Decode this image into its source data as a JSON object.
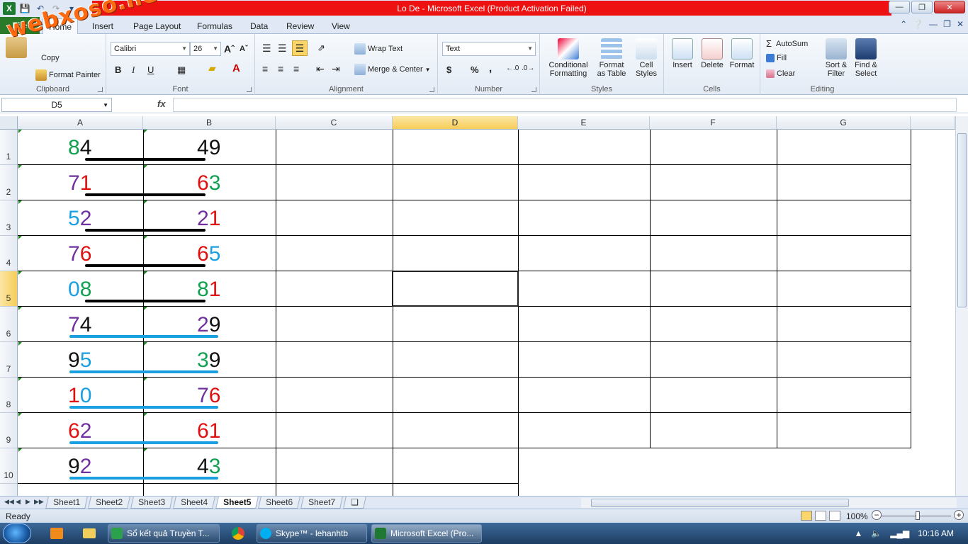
{
  "window": {
    "title": "Lo De  -  Microsoft Excel (Product Activation Failed)"
  },
  "logo": {
    "text": "webxoso.net"
  },
  "tabs": {
    "file": "File",
    "items": [
      "Home",
      "Insert",
      "Page Layout",
      "Formulas",
      "Data",
      "Review",
      "View"
    ],
    "active": "Home"
  },
  "clipboard": {
    "copy": "Copy",
    "format_painter": "Format Painter",
    "label": "Clipboard"
  },
  "font": {
    "name": "Calibri",
    "size": "26",
    "bold": "B",
    "italic": "I",
    "underline": "U",
    "label": "Font"
  },
  "alignment": {
    "wrap": "Wrap Text",
    "merge": "Merge & Center",
    "label": "Alignment"
  },
  "number": {
    "format": "Text",
    "currency": "$",
    "percent": "%",
    "comma": ",",
    "label": "Number"
  },
  "styles": {
    "conditional": [
      "Conditional",
      "Formatting"
    ],
    "table": [
      "Format",
      "as Table"
    ],
    "cell": [
      "Cell",
      "Styles"
    ],
    "label": "Styles"
  },
  "cells": {
    "insert": "Insert",
    "delete": "Delete",
    "format": "Format",
    "label": "Cells"
  },
  "editing": {
    "autosum": "AutoSum",
    "fill": "Fill",
    "clear": "Clear",
    "sort": [
      "Sort &",
      "Filter"
    ],
    "find": [
      "Find &",
      "Select"
    ],
    "label": "Editing"
  },
  "formula_bar": {
    "name_box": "D5",
    "fx": "fx",
    "value": ""
  },
  "columns": [
    "A",
    "B",
    "C",
    "D",
    "E",
    "F",
    "G"
  ],
  "selected_column": "D",
  "rows": [
    "1",
    "2",
    "3",
    "4",
    "5",
    "6",
    "7",
    "8",
    "9",
    "10"
  ],
  "selected_row": "5",
  "active_cell": "D5",
  "cells_data": [
    {
      "a": [
        [
          "8",
          "#10a050"
        ],
        [
          "4",
          "#111111"
        ]
      ],
      "b": [
        [
          "4",
          "#111111"
        ],
        [
          "9",
          "#111111"
        ]
      ],
      "line": "#000000"
    },
    {
      "a": [
        [
          "7",
          "#7030a0"
        ],
        [
          "1",
          "#e01010"
        ]
      ],
      "b": [
        [
          "6",
          "#e01010"
        ],
        [
          "3",
          "#10a050"
        ]
      ],
      "line": "#000000"
    },
    {
      "a": [
        [
          "5",
          "#1aa0e0"
        ],
        [
          "2",
          "#7030a0"
        ]
      ],
      "b": [
        [
          "2",
          "#7030a0"
        ],
        [
          "1",
          "#e01010"
        ]
      ],
      "line": "#000000"
    },
    {
      "a": [
        [
          "7",
          "#7030a0"
        ],
        [
          "6",
          "#e01010"
        ]
      ],
      "b": [
        [
          "6",
          "#e01010"
        ],
        [
          "5",
          "#1aa0e0"
        ]
      ],
      "line": "#000000"
    },
    {
      "a": [
        [
          "0",
          "#1aa0e0"
        ],
        [
          "8",
          "#10a050"
        ]
      ],
      "b": [
        [
          "8",
          "#10a050"
        ],
        [
          "1",
          "#e01010"
        ]
      ],
      "line": "#000000"
    },
    {
      "a": [
        [
          "7",
          "#7030a0"
        ],
        [
          "4",
          "#111111"
        ]
      ],
      "b": [
        [
          "2",
          "#7030a0"
        ],
        [
          "9",
          "#111111"
        ]
      ],
      "line": "#1aa0e0"
    },
    {
      "a": [
        [
          "9",
          "#111111"
        ],
        [
          "5",
          "#1aa0e0"
        ]
      ],
      "b": [
        [
          "3",
          "#10a050"
        ],
        [
          "9",
          "#111111"
        ]
      ],
      "line": "#1aa0e0"
    },
    {
      "a": [
        [
          "1",
          "#e01010"
        ],
        [
          "0",
          "#1aa0e0"
        ]
      ],
      "b": [
        [
          "7",
          "#7030a0"
        ],
        [
          "6",
          "#e01010"
        ]
      ],
      "line": "#1aa0e0"
    },
    {
      "a": [
        [
          "6",
          "#e01010"
        ],
        [
          "2",
          "#7030a0"
        ]
      ],
      "b": [
        [
          "6",
          "#e01010"
        ],
        [
          "1",
          "#e01010"
        ]
      ],
      "line": "#1aa0e0"
    },
    {
      "a": [
        [
          "9",
          "#111111"
        ],
        [
          "2",
          "#7030a0"
        ]
      ],
      "b": [
        [
          "4",
          "#111111"
        ],
        [
          "3",
          "#10a050"
        ]
      ],
      "line": "#1aa0e0"
    }
  ],
  "sheets": [
    "Sheet1",
    "Sheet2",
    "Sheet3",
    "Sheet4",
    "Sheet5",
    "Sheet6",
    "Sheet7"
  ],
  "active_sheet": "Sheet5",
  "status": {
    "ready": "Ready",
    "zoom": "100%"
  },
  "taskbar": {
    "items": [
      "Sổ kết quả Truyền T...",
      "Skype™ - lehanhtb",
      "Microsoft Excel (Pro..."
    ],
    "clock": "10:16 AM"
  }
}
